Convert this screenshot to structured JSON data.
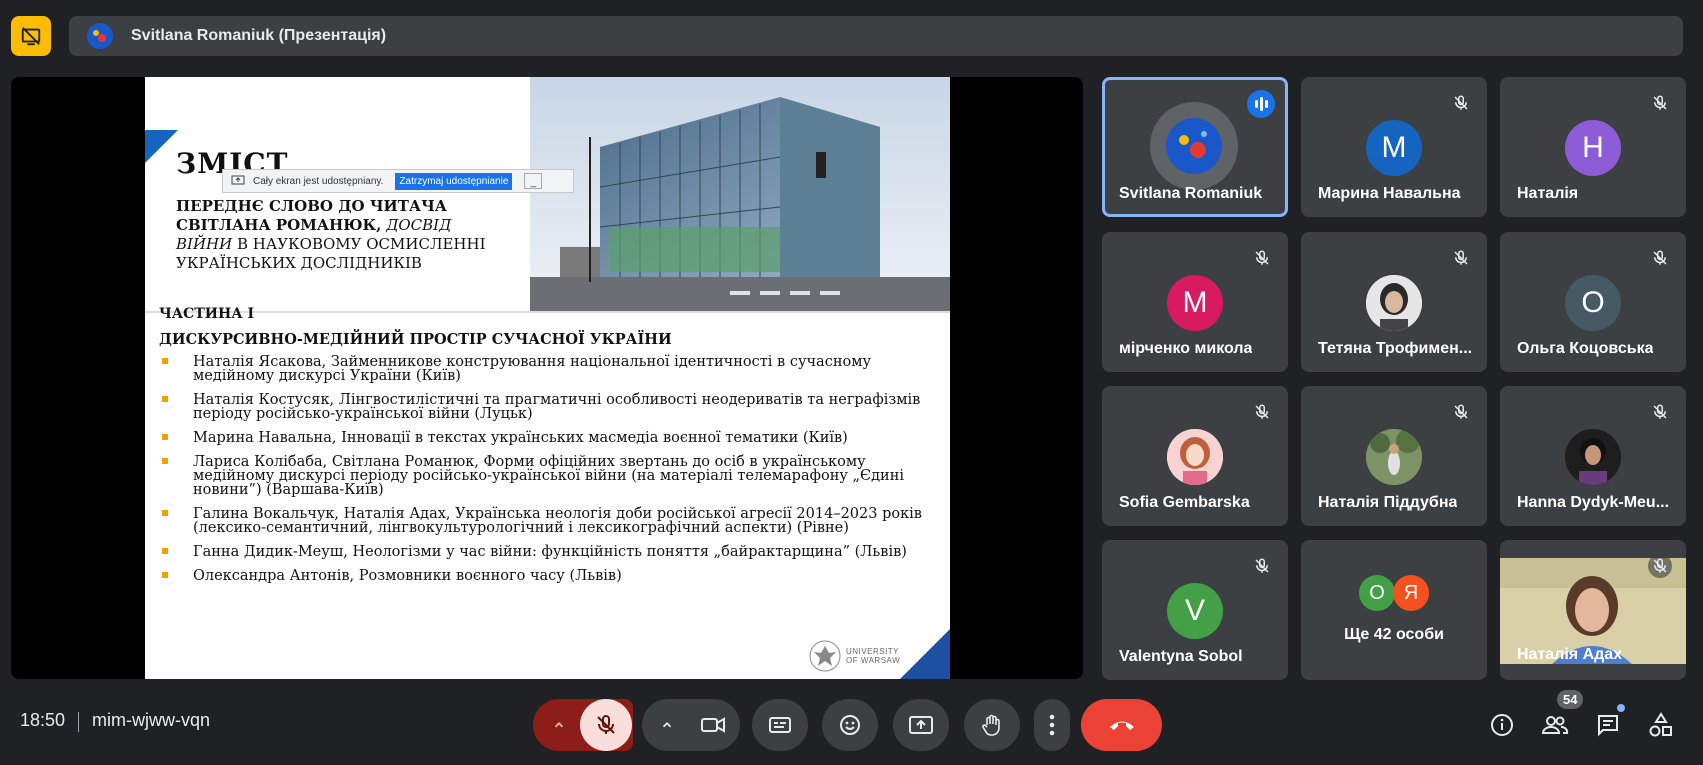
{
  "top_bar": {
    "presenter_label": "Svitlana Romaniuk (Презентація)"
  },
  "slide": {
    "title": "ЗМІСТ",
    "sub_line1": "ПЕРЕДНЄ СЛОВО ДО ЧИТАЧА",
    "sub_line2_bold": "СВІТЛАНА РОМАНЮК,",
    "sub_line2_italic": "ДОСВІД",
    "sub_line3_italic": "ВІЙНИ",
    "sub_line3_rest": "В НАУКОВОМУ ОСМИСЛЕННІ",
    "sub_line4": "УКРАЇНСЬКИХ ДОСЛІДНИКІВ",
    "part_label": "ЧАСТИНА І",
    "part_title": "ДИСКУРСИВНО-МЕДІЙНИЙ ПРОСТІР СУЧАСНОЇ УКРАЇНИ",
    "items": [
      "Наталія Ясакова, Займенникове конструювання національної ідентичності в сучасному медійному дискурсі України (Київ)",
      "Наталія Костусяк, Лінгвостилістичні та прагматичні особливості неодериватів та неграфізмів періоду російсько-української війни (Луцьк)",
      "Марина Навальна, Інновації в текстах українських масмедіа воєнної тематики (Київ)",
      "Лариса  Колібаба, Світлана Романюк, Форми офіційних звертань до осіб в українському медійному дискурсі періоду російсько-української війни (на матеріалі телемарафону „Єдині новини”) (Варшава-Київ)",
      "Галина Вокальчук, Наталія Адах, Українська неологія доби російської агресії 2014–2023 років (лексико-семантичний, лінгвокультурологічний і лексикографічний аспекти) (Рівне)",
      "Ганна Дидик-Меуш, Неологізми у час війни: функційність поняття „байрактарщина” (Львів)",
      "Олександра Антонів, Розмовники воєнного часу (Львів)"
    ],
    "logo_line1": "UNIVERSITY",
    "logo_line2": "OF WARSAW"
  },
  "share_bar": {
    "message": "Cały ekran jest udostępniany.",
    "stop_label": "Zatrzymaj udostępnianie",
    "minimize_label": "_"
  },
  "participants": [
    {
      "name": "Svitlana Romaniuk",
      "initial": "",
      "color": "#1a57c8",
      "speaking": true
    },
    {
      "name": "Марина Навальна",
      "initial": "М",
      "color": "#1565c0",
      "speaking": false
    },
    {
      "name": "Наталія",
      "initial": "Н",
      "color": "#8e5bd6",
      "speaking": false
    },
    {
      "name": "мірченко микола",
      "initial": "М",
      "color": "#d81b60",
      "speaking": false
    },
    {
      "name": "Тетяна Трофимен...",
      "initial": "",
      "color": "#888888",
      "speaking": false
    },
    {
      "name": "Ольга Коцовська",
      "initial": "О",
      "color": "#455a64",
      "speaking": false
    },
    {
      "name": "Sofia Gembarska",
      "initial": "",
      "color": "#f6c7c7",
      "speaking": false
    },
    {
      "name": "Наталія Піддубна",
      "initial": "",
      "color": "#6d7f5a",
      "speaking": false
    },
    {
      "name": "Hanna Dydyk-Meu...",
      "initial": "",
      "color": "#2a2a2a",
      "speaking": false
    },
    {
      "name": "Valentyna Sobol",
      "initial": "V",
      "color": "#43a047",
      "speaking": false
    }
  ],
  "more_tile": {
    "avatar1": "О",
    "avatar2": "Я",
    "label": "Ще 42 особи"
  },
  "video_tile": {
    "name": "Наталія Адах"
  },
  "bottom_bar": {
    "time": "18:50",
    "meeting_code": "mim-wjww-vqn",
    "participant_count": "54"
  },
  "colors": {
    "background": "#202124",
    "tile": "#3c4043",
    "accent_yellow": "#fbbc04",
    "end_call": "#ea4335",
    "mic_off_bg": "#f9dedc"
  }
}
